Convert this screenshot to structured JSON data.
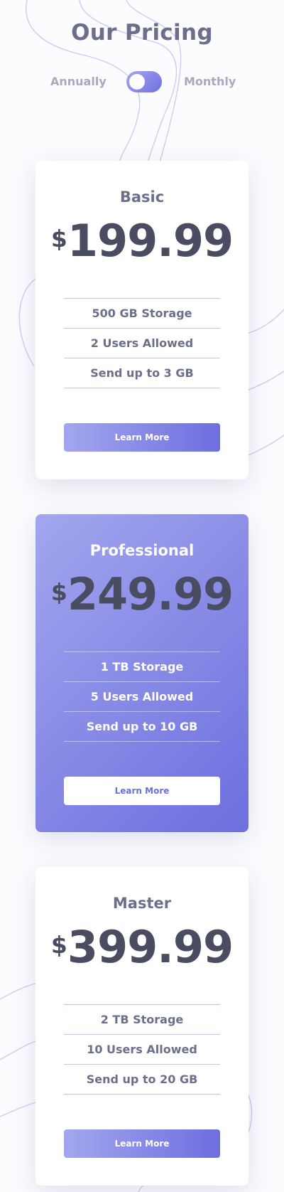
{
  "header": {
    "title": "Our Pricing",
    "toggle_left_label": "Annually",
    "toggle_right_label": "Monthly",
    "toggle_state": "annually"
  },
  "plans": [
    {
      "name": "Basic",
      "currency": "$",
      "price": "199.99",
      "features": [
        "500 GB Storage",
        "2 Users Allowed",
        "Send up to 3 GB"
      ],
      "button_label": "Learn More",
      "highlighted": false
    },
    {
      "name": "Professional",
      "currency": "$",
      "price": "249.99",
      "features": [
        "1 TB Storage",
        "5 Users Allowed",
        "Send up to 10 GB"
      ],
      "button_label": "Learn More",
      "highlighted": true
    },
    {
      "name": "Master",
      "currency": "$",
      "price": "399.99",
      "features": [
        "2 TB Storage",
        "10 Users Allowed",
        "Send up to 20 GB"
      ],
      "button_label": "Learn More",
      "highlighted": false
    }
  ],
  "colors": {
    "accent_light": "#a3a6ee",
    "accent_dark": "#6c6fde",
    "price_text": "#4a4d61",
    "heading_text": "#6b6f8c",
    "muted_text": "#a7a9bf",
    "background": "#fcfcff"
  }
}
